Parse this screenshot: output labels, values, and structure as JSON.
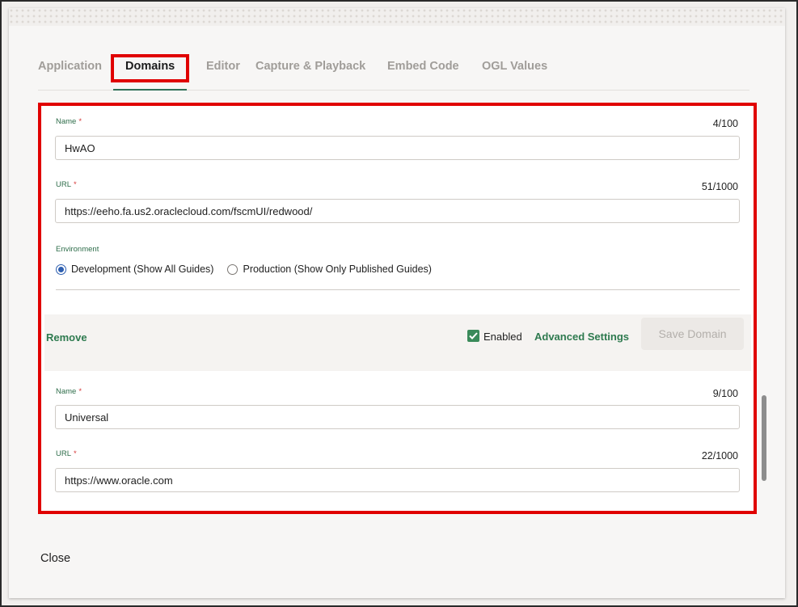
{
  "tabs": [
    {
      "label": "Application"
    },
    {
      "label": "Domains"
    },
    {
      "label": "Editor"
    },
    {
      "label": "Capture & Playback"
    },
    {
      "label": "Embed Code"
    },
    {
      "label": "OGL Values"
    }
  ],
  "active_tab": "Domains",
  "domains": [
    {
      "name_label": "Name",
      "name_value": "HwAO",
      "name_counter": "4/100",
      "url_label": "URL",
      "url_value": "https://eeho.fa.us2.oraclecloud.com/fscmUI/redwood/",
      "url_counter": "51/1000",
      "environment_label": "Environment",
      "environment_options": [
        {
          "label": "Development (Show All Guides)",
          "selected": true
        },
        {
          "label": "Production (Show Only Published Guides)",
          "selected": false
        }
      ],
      "actions": {
        "remove": "Remove",
        "enabled_label": "Enabled",
        "enabled": true,
        "advanced_settings": "Advanced Settings",
        "save_domain": "Save Domain"
      }
    },
    {
      "name_label": "Name",
      "name_value": "Universal",
      "name_counter": "9/100",
      "url_label": "URL",
      "url_value": "https://www.oracle.com",
      "url_counter": "22/1000"
    }
  ],
  "required_marker": "*",
  "footer": {
    "close": "Close"
  },
  "colors": {
    "highlight": "#e00000",
    "accent_green": "#2e7a4f",
    "radio_blue": "#2e5fb0"
  }
}
